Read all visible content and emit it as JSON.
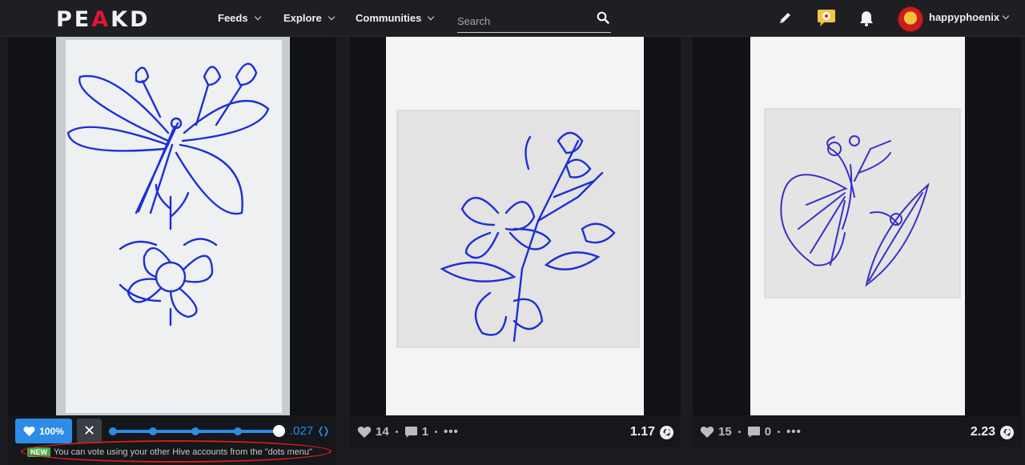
{
  "header": {
    "logo_text": "PEAKD",
    "nav": [
      {
        "label": "Feeds"
      },
      {
        "label": "Explore"
      },
      {
        "label": "Communities"
      }
    ],
    "search_placeholder": "Search",
    "username": "happyphoenix"
  },
  "cards": [
    {
      "vote": {
        "percent": "100%",
        "value": ".027",
        "weight": 1.0,
        "notice_badge": "NEW",
        "notice_text": "You can vote using your other Hive accounts from the \"dots menu\""
      }
    },
    {
      "likes": "14",
      "comments": "1",
      "payout": "1.17"
    },
    {
      "likes": "15",
      "comments": "0",
      "payout": "2.23"
    }
  ],
  "colors": {
    "accent": "#2d8ce6",
    "brand_red": "#e31337",
    "ink_blue": "#1d2fd6"
  }
}
